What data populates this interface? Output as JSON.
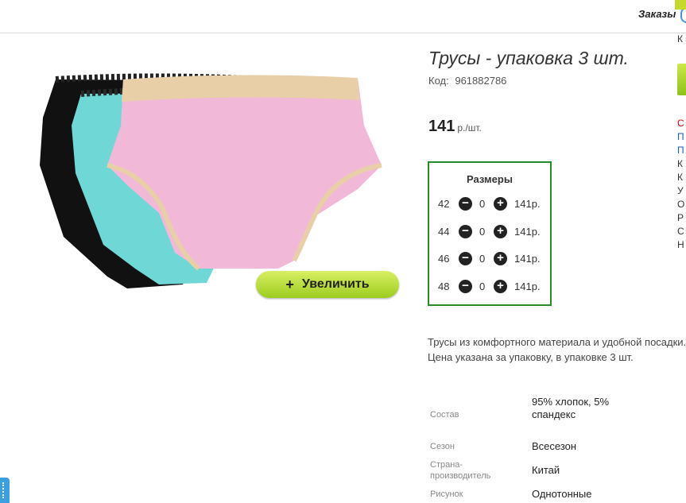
{
  "header": {
    "orders_label": "Заказы"
  },
  "product": {
    "title": "Трусы - упаковка 3 шт.",
    "code_label": "Код:",
    "code_value": "961882786",
    "price_value": "141",
    "price_unit": "р./шт.",
    "zoom_button_label": "Увеличить",
    "zoom_icon": "+",
    "description": "Трусы из комфортного материала и удобной посадки. Цена указана за упаковку, в упаковке 3 шт."
  },
  "sizes": {
    "title": "Размеры",
    "rows": [
      {
        "size": "42",
        "qty": "0",
        "price": "141р."
      },
      {
        "size": "44",
        "qty": "0",
        "price": "141р."
      },
      {
        "size": "46",
        "qty": "0",
        "price": "141р."
      },
      {
        "size": "48",
        "qty": "0",
        "price": "141р."
      }
    ],
    "minus_icon": "−",
    "plus_icon": "+"
  },
  "specs": [
    {
      "label": "Состав",
      "value": "95% хлопок, 5% спандекс"
    },
    {
      "label": "Сезон",
      "value": "Всесезон"
    },
    {
      "label": "Страна-производитель",
      "value": "Китай"
    },
    {
      "label": "Рисунок",
      "value": "Однотонные"
    }
  ],
  "right_column": {
    "top_letter": "К",
    "letters": [
      "С",
      "П",
      "П",
      "К",
      "К",
      "У",
      "О",
      "Р",
      "С",
      "Н"
    ]
  },
  "colors": {
    "sizes_border": "#2a8a2a",
    "zoom_button": "#b5dd36",
    "product_pink": "#f2b8d8",
    "product_aqua": "#6fd8d6",
    "product_black": "#111111",
    "lace_beige": "#e8cfa8"
  }
}
